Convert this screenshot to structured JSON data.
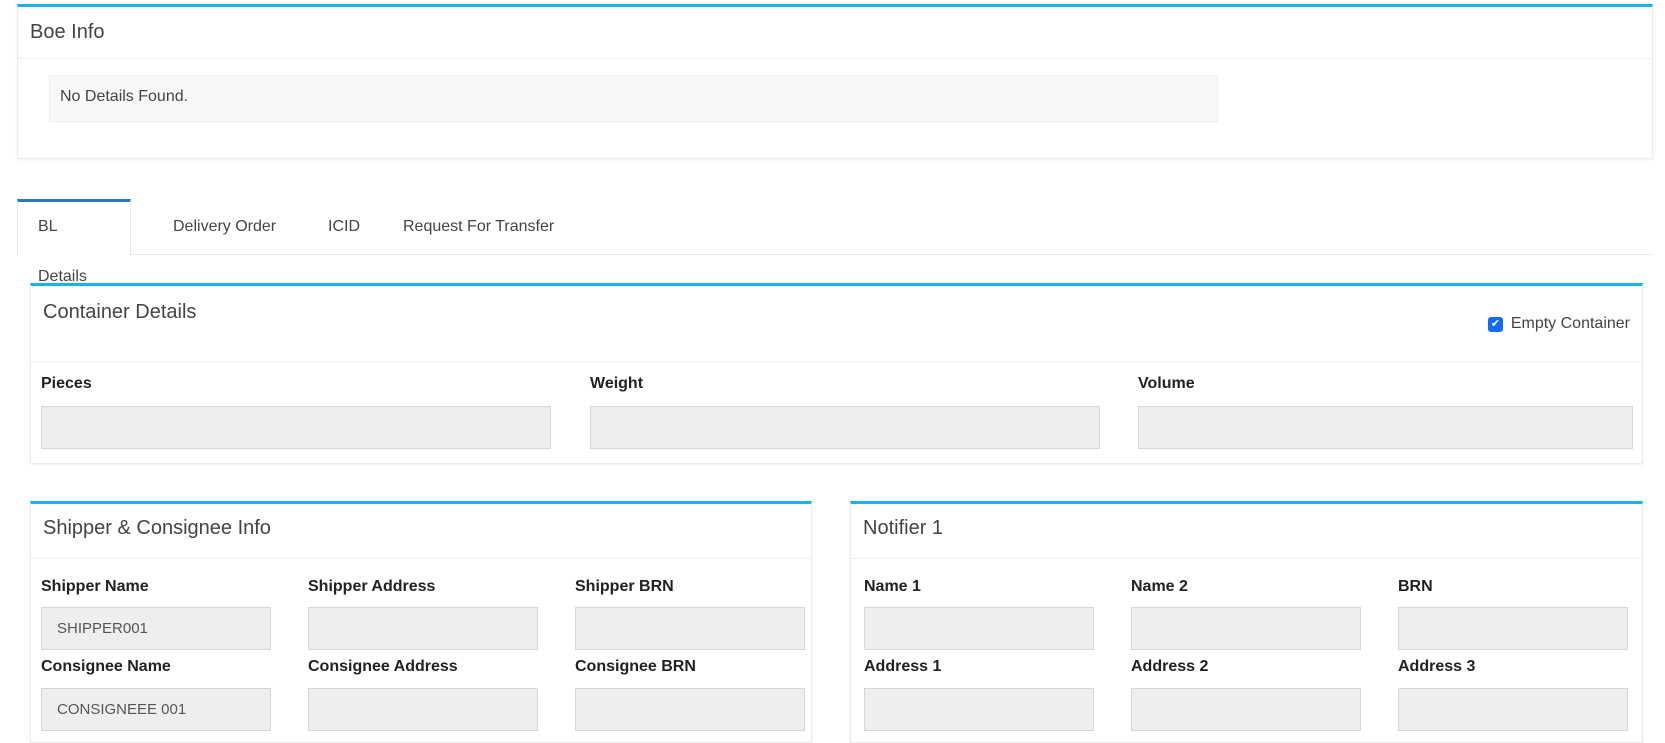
{
  "boe": {
    "title": "Boe Info",
    "empty_message": "No Details Found."
  },
  "tabs": [
    {
      "label": "BL Details",
      "active": true
    },
    {
      "label": "Delivery Order",
      "active": false
    },
    {
      "label": "ICID",
      "active": false
    },
    {
      "label": "Request For Transfer",
      "active": false
    }
  ],
  "container": {
    "title": "Container Details",
    "empty_container_label": "Empty Container",
    "empty_container_checked": true,
    "fields": {
      "pieces": {
        "label": "Pieces",
        "value": ""
      },
      "weight": {
        "label": "Weight",
        "value": ""
      },
      "volume": {
        "label": "Volume",
        "value": ""
      }
    }
  },
  "shipper": {
    "title": "Shipper & Consignee Info",
    "fields": {
      "shipper_name": {
        "label": "Shipper Name",
        "value": "SHIPPER001"
      },
      "shipper_address": {
        "label": "Shipper Address",
        "value": ""
      },
      "shipper_brn": {
        "label": "Shipper BRN",
        "value": ""
      },
      "consignee_name": {
        "label": "Consignee Name",
        "value": "CONSIGNEEE 001"
      },
      "consignee_address": {
        "label": "Consignee Address",
        "value": ""
      },
      "consignee_brn": {
        "label": "Consignee BRN",
        "value": ""
      }
    }
  },
  "notifier": {
    "title": "Notifier 1",
    "fields": {
      "name1": {
        "label": "Name 1",
        "value": ""
      },
      "name2": {
        "label": "Name 2",
        "value": ""
      },
      "brn": {
        "label": "BRN",
        "value": ""
      },
      "address1": {
        "label": "Address 1",
        "value": ""
      },
      "address2": {
        "label": "Address 2",
        "value": ""
      },
      "address3": {
        "label": "Address 3",
        "value": ""
      }
    }
  },
  "colors": {
    "accent": "#17b4e6",
    "tab_active": "#2f7ab8",
    "checkbox": "#0d6efd",
    "input_bg": "#eeeeee"
  }
}
